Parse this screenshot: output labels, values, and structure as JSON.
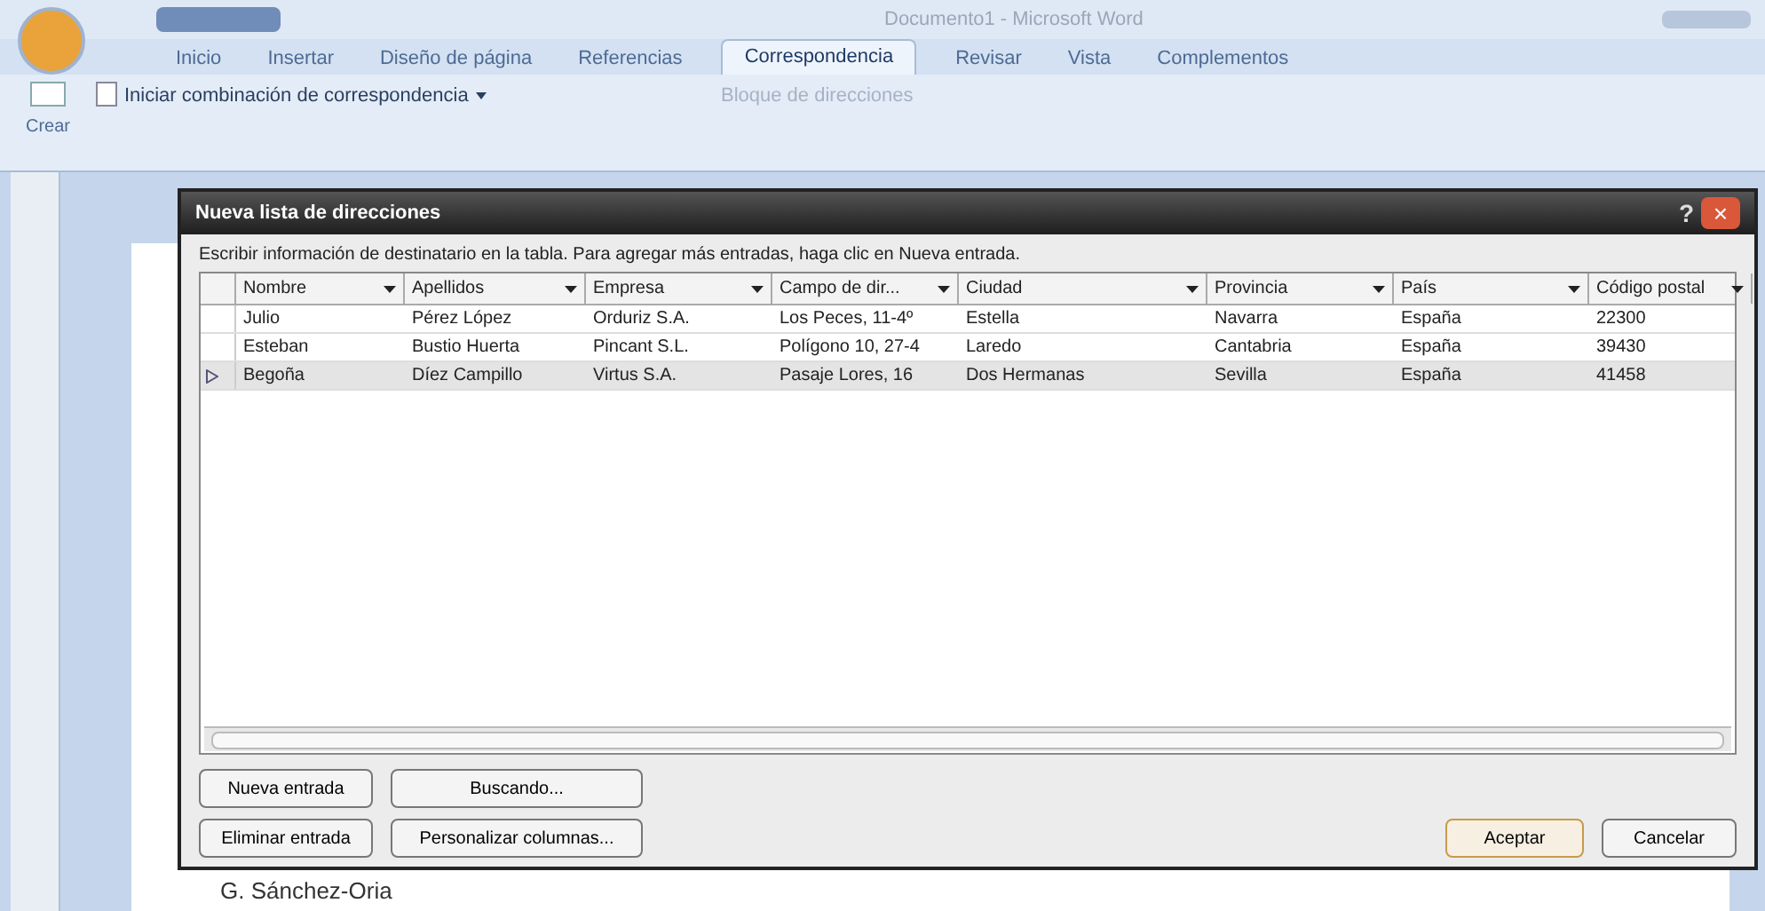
{
  "window": {
    "title": "Documento1 - Microsoft Word"
  },
  "ribbon_tabs": [
    {
      "label": "Inicio",
      "selected": false
    },
    {
      "label": "Insertar",
      "selected": false
    },
    {
      "label": "Diseño de página",
      "selected": false
    },
    {
      "label": "Referencias",
      "selected": false
    },
    {
      "label": "Correspondencia",
      "selected": true
    },
    {
      "label": "Revisar",
      "selected": false
    },
    {
      "label": "Vista",
      "selected": false
    },
    {
      "label": "Complementos",
      "selected": false
    }
  ],
  "ribbon": {
    "create_label": "Crear",
    "start_merge": "Iniciar combinación de correspondencia",
    "address_block": "Bloque de direcciones"
  },
  "dialog": {
    "title": "Nueva lista de direcciones",
    "help": "?",
    "close": "×",
    "instruction": "Escribir información de destinatario en la tabla. Para agregar más entradas, haga clic en Nueva entrada.",
    "columns": [
      "Nombre",
      "Apellidos",
      "Empresa",
      "Campo de dir...",
      "Ciudad",
      "Provincia",
      "País",
      "Código postal"
    ],
    "rows": [
      {
        "selected": false,
        "cells": [
          "Julio",
          "Pérez López",
          "Orduriz S.A.",
          "Los Peces, 11-4º",
          "Estella",
          "Navarra",
          "España",
          "22300"
        ]
      },
      {
        "selected": false,
        "cells": [
          "Esteban",
          "Bustio Huerta",
          "Pincant S.L.",
          "Polígono 10, 27-4",
          "Laredo",
          "Cantabria",
          "España",
          "39430"
        ]
      },
      {
        "selected": true,
        "cells": [
          "Begoña",
          "Díez Campillo",
          "Virtus S.A.",
          "Pasaje Lores, 16",
          "Dos Hermanas",
          "Sevilla",
          "España",
          "41458"
        ]
      }
    ],
    "buttons_left": [
      [
        "Nueva entrada",
        "Buscando..."
      ],
      [
        "Eliminar entrada",
        "Personalizar columnas..."
      ]
    ],
    "ok": "Aceptar",
    "cancel": "Cancelar"
  },
  "document": {
    "text": "G. Sánchez-Oria"
  }
}
